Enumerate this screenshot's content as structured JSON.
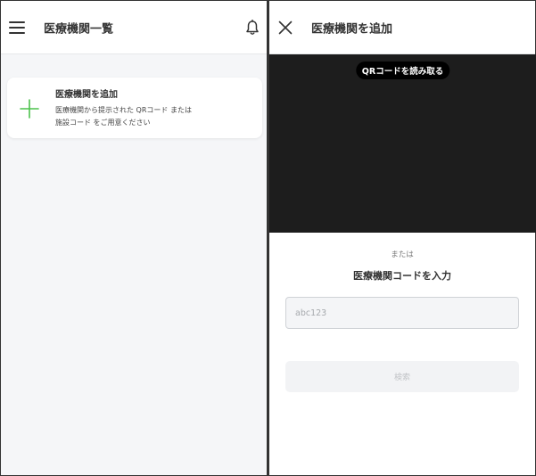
{
  "left_screen": {
    "header": {
      "title": "医療機関一覧",
      "menu_icon": "hamburger-menu-icon",
      "notification_icon": "bell-icon"
    },
    "add_card": {
      "icon": "plus-icon",
      "title": "医療機関を追加",
      "description_line1": "医療機関から提示された QRコード または",
      "description_line2": "施設コード をご用意ください"
    }
  },
  "right_screen": {
    "header": {
      "title": "医療機関を追加",
      "close_icon": "close-icon"
    },
    "camera": {
      "label": "QRコードを読み取る"
    },
    "or_label": "または",
    "code_heading": "医療機関コードを入力",
    "code_input": {
      "value": "",
      "placeholder": "abc123"
    },
    "search_button": {
      "label": "検索"
    }
  },
  "colors": {
    "accent_green": "#4cc24c",
    "camera_background": "#1d1d1d",
    "page_background": "#f5f6f8"
  }
}
